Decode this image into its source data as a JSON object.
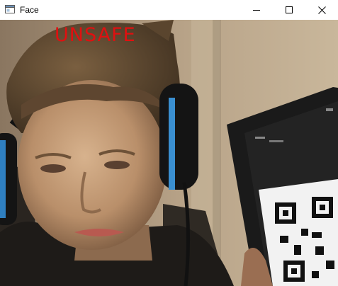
{
  "window": {
    "title": "Face",
    "icon": "window-app-icon",
    "controls": [
      "minimize-icon",
      "maximize-icon",
      "close-icon"
    ]
  },
  "camera_feed": {
    "status_label": "UNSAFE",
    "status_color": "#e01010"
  }
}
